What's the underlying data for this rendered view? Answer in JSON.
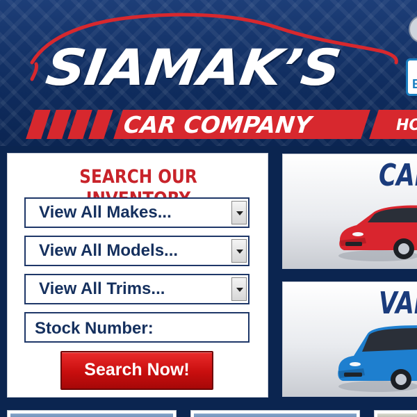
{
  "brand": {
    "name": "SIAMAK’S",
    "tagline": "CAR COMPANY"
  },
  "nav": {
    "items": [
      {
        "label": "HO"
      }
    ]
  },
  "badges": {
    "bottom_letter": "E"
  },
  "search": {
    "title": "SEARCH OUR INVENTORY",
    "makes": {
      "selected": "View All Makes..."
    },
    "models": {
      "selected": "View All Models..."
    },
    "trims": {
      "selected": "View All Trims..."
    },
    "stock_label": "Stock Number:",
    "button_label": "Search Now!"
  },
  "categories": [
    {
      "label": "CAR",
      "icon": "red-sedan-image"
    },
    {
      "label": "VAN",
      "icon": "blue-minivan-image"
    }
  ],
  "colors": {
    "brand_red": "#d7282e",
    "header_navy": "#0f2c5e",
    "title_blue": "#1a3b7c",
    "button_red": "#c80e0e"
  }
}
